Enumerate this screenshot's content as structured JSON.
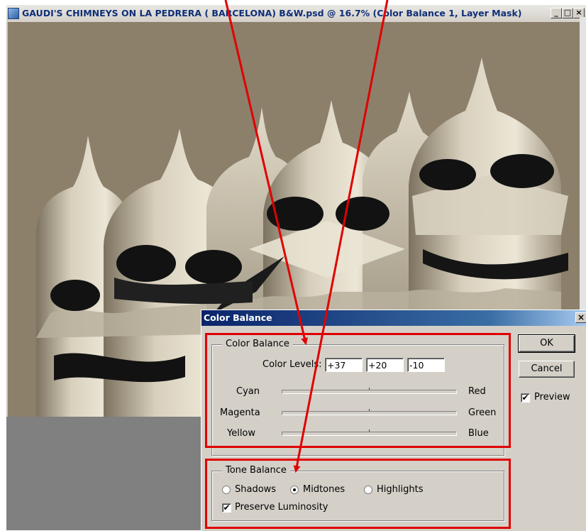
{
  "document_window": {
    "title": "GAUDI'S CHIMNEYS ON LA PEDRERA ( BARCELONA) B&W.psd @ 16.7% (Color Balance 1, Layer Mask)",
    "minimize_label": "_",
    "maximize_label": "□",
    "close_label": "×"
  },
  "dialog": {
    "title": "Color Balance",
    "close_label": "×",
    "color_balance_group": {
      "legend": "Color Balance",
      "levels_label": "Color Levels:",
      "levels": [
        "+37",
        "+20",
        "-10"
      ],
      "sliders": [
        {
          "left": "Cyan",
          "right": "Red",
          "value": 37
        },
        {
          "left": "Magenta",
          "right": "Green",
          "value": 20
        },
        {
          "left": "Yellow",
          "right": "Blue",
          "value": -10
        }
      ]
    },
    "tone_balance_group": {
      "legend": "Tone Balance",
      "options": [
        "Shadows",
        "Midtones",
        "Highlights"
      ],
      "selected": "Midtones",
      "preserve_luminosity_label": "Preserve Luminosity",
      "preserve_luminosity_checked": true
    },
    "buttons": {
      "ok": "OK",
      "cancel": "Cancel"
    },
    "preview_label": "Preview",
    "preview_checked": true
  },
  "colors": {
    "callout": "#e00000",
    "photo_sky": "#8c806b",
    "dialog_face": "#d4d0c8",
    "title_bar": "#0a246a"
  },
  "icons": [
    "photoshop-document-icon",
    "minimize-icon",
    "maximize-icon",
    "close-icon",
    "slider-thumb-icon",
    "check-icon",
    "radio-icon"
  ]
}
